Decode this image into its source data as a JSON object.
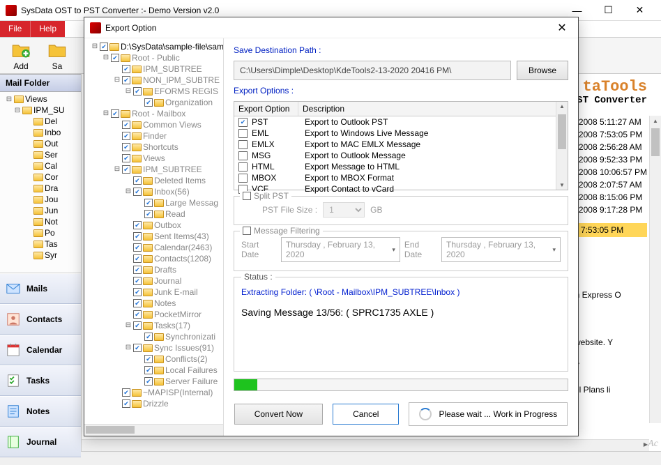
{
  "window": {
    "title": "SysData OST to PST Converter :- Demo Version v2.0",
    "min": "—",
    "max": "☐",
    "close": "✕"
  },
  "menu": {
    "file": "File",
    "help": "Help"
  },
  "toolbar": {
    "add": "Add",
    "save_partial": "Sa"
  },
  "brand": {
    "name": "taTools",
    "sub": "ST Converter"
  },
  "left": {
    "header": "Mail Folder",
    "tree": [
      "Views",
      "IPM_SU",
      "Del",
      "Inbo",
      "Out",
      "Ser",
      "Cal",
      "Cor",
      "Dra",
      "Jou",
      "Jun",
      "Not",
      "Po",
      "Tas",
      "Syr"
    ],
    "nav": [
      {
        "label": "Mails",
        "icon": "mail"
      },
      {
        "label": "Contacts",
        "icon": "contacts"
      },
      {
        "label": "Calendar",
        "icon": "calendar"
      },
      {
        "label": "Tasks",
        "icon": "tasks"
      },
      {
        "label": "Notes",
        "icon": "notes"
      },
      {
        "label": "Journal",
        "icon": "journal"
      }
    ]
  },
  "dates": [
    "2008 5:11:27 AM",
    "2008 7:53:05 PM",
    "2008 2:56:28 AM",
    "2008 9:52:33 PM",
    "2008 10:06:57 PM",
    "2008 2:07:57 AM",
    "2008 8:15:06 PM",
    "2008 9:17:28 PM"
  ],
  "selected_date": "7:53:05 PM",
  "msg_body": [
    "an Express O",
    ":",
    "l website. Y",
    "07",
    "vel Plans li"
  ],
  "dialog": {
    "title": "Export Option",
    "save_label": "Save Destination Path :",
    "path": "C:\\Users\\Dimple\\Desktop\\KdeTools2-13-2020 20416 PM\\",
    "browse": "Browse",
    "export_options_label": "Export Options :",
    "table_hdr_opt": "Export Option",
    "table_hdr_desc": "Description",
    "options": [
      {
        "name": "PST",
        "desc": "Export to Outlook PST",
        "checked": true
      },
      {
        "name": "EML",
        "desc": "Export to Windows Live Message",
        "checked": false
      },
      {
        "name": "EMLX",
        "desc": "Export to MAC EMLX Message",
        "checked": false
      },
      {
        "name": "MSG",
        "desc": "Export to Outlook Message",
        "checked": false
      },
      {
        "name": "HTML",
        "desc": "Export Message to HTML",
        "checked": false
      },
      {
        "name": "MBOX",
        "desc": "Export to MBOX Format",
        "checked": false
      },
      {
        "name": "VCF",
        "desc": "Export Contact to vCard",
        "checked": false
      }
    ],
    "split_label": "Split PST",
    "split_size_label": "PST File Size :",
    "split_size_value": "1",
    "split_unit": "GB",
    "filter_label": "Message Filtering",
    "start_date_label": "Start Date",
    "end_date_label": "End Date",
    "date_value": "Thursday ,  February  13, 2020",
    "status_label": "Status :",
    "status_line": "Extracting Folder: ( \\Root - Mailbox\\IPM_SUBTREE\\Inbox )",
    "saving_line": "Saving Message 13/56: ( SPRC1735 AXLE )",
    "convert": "Convert Now",
    "cancel": "Cancel",
    "wait": "Please wait ... Work in Progress",
    "tree": [
      {
        "d": 0,
        "t": "D:\\SysData\\sample-file\\samp",
        "c": true,
        "dim": false,
        "exp": "-"
      },
      {
        "d": 1,
        "t": "Root - Public",
        "c": true,
        "dim": true,
        "exp": "-"
      },
      {
        "d": 2,
        "t": "IPM_SUBTREE",
        "c": true,
        "dim": true,
        "exp": ""
      },
      {
        "d": 2,
        "t": "NON_IPM_SUBTRE",
        "c": true,
        "dim": true,
        "exp": "-"
      },
      {
        "d": 3,
        "t": "EFORMS REGIS",
        "c": true,
        "dim": true,
        "exp": "-"
      },
      {
        "d": 4,
        "t": "Organization",
        "c": true,
        "dim": true,
        "exp": ""
      },
      {
        "d": 1,
        "t": "Root - Mailbox",
        "c": true,
        "dim": true,
        "exp": "-"
      },
      {
        "d": 2,
        "t": "Common Views",
        "c": true,
        "dim": true,
        "exp": ""
      },
      {
        "d": 2,
        "t": "Finder",
        "c": true,
        "dim": true,
        "exp": ""
      },
      {
        "d": 2,
        "t": "Shortcuts",
        "c": true,
        "dim": true,
        "exp": ""
      },
      {
        "d": 2,
        "t": "Views",
        "c": true,
        "dim": true,
        "exp": ""
      },
      {
        "d": 2,
        "t": "IPM_SUBTREE",
        "c": true,
        "dim": true,
        "exp": "-"
      },
      {
        "d": 3,
        "t": "Deleted Items",
        "c": true,
        "dim": true,
        "exp": ""
      },
      {
        "d": 3,
        "t": "Inbox(56)",
        "c": true,
        "dim": true,
        "exp": "-"
      },
      {
        "d": 4,
        "t": "Large Messag",
        "c": true,
        "dim": true,
        "exp": ""
      },
      {
        "d": 4,
        "t": "Read",
        "c": true,
        "dim": true,
        "exp": ""
      },
      {
        "d": 3,
        "t": "Outbox",
        "c": true,
        "dim": true,
        "exp": ""
      },
      {
        "d": 3,
        "t": "Sent Items(43)",
        "c": true,
        "dim": true,
        "exp": ""
      },
      {
        "d": 3,
        "t": "Calendar(2463)",
        "c": true,
        "dim": true,
        "exp": ""
      },
      {
        "d": 3,
        "t": "Contacts(1208)",
        "c": true,
        "dim": true,
        "exp": ""
      },
      {
        "d": 3,
        "t": "Drafts",
        "c": true,
        "dim": true,
        "exp": ""
      },
      {
        "d": 3,
        "t": "Journal",
        "c": true,
        "dim": true,
        "exp": ""
      },
      {
        "d": 3,
        "t": "Junk E-mail",
        "c": true,
        "dim": true,
        "exp": ""
      },
      {
        "d": 3,
        "t": "Notes",
        "c": true,
        "dim": true,
        "exp": ""
      },
      {
        "d": 3,
        "t": "PocketMirror",
        "c": true,
        "dim": true,
        "exp": ""
      },
      {
        "d": 3,
        "t": "Tasks(17)",
        "c": true,
        "dim": true,
        "exp": "-"
      },
      {
        "d": 4,
        "t": "Synchronizati",
        "c": true,
        "dim": true,
        "exp": ""
      },
      {
        "d": 3,
        "t": "Sync Issues(91)",
        "c": true,
        "dim": true,
        "exp": "-"
      },
      {
        "d": 4,
        "t": "Conflicts(2)",
        "c": true,
        "dim": true,
        "exp": ""
      },
      {
        "d": 4,
        "t": "Local Failures",
        "c": true,
        "dim": true,
        "exp": ""
      },
      {
        "d": 4,
        "t": "Server Failure",
        "c": true,
        "dim": true,
        "exp": ""
      },
      {
        "d": 2,
        "t": "~MAPISP(Internal)",
        "c": true,
        "dim": true,
        "exp": ""
      },
      {
        "d": 2,
        "t": "Drizzle",
        "c": true,
        "dim": true,
        "exp": ""
      }
    ]
  },
  "watermark": "Ac"
}
